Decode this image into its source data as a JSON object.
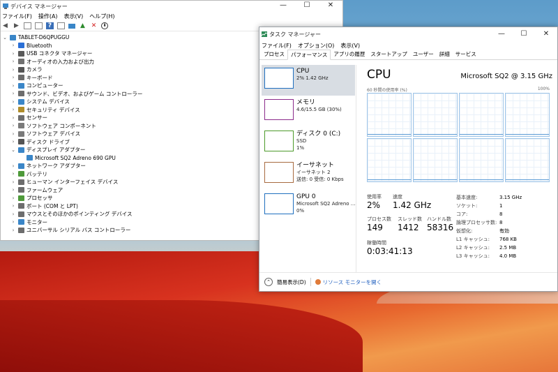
{
  "devmgr": {
    "title": "デバイス マネージャー",
    "menu": [
      "ファイル(F)",
      "操作(A)",
      "表示(V)",
      "ヘルプ(H)"
    ],
    "root": "TABLET-D6QPUGGU",
    "items": [
      {
        "label": "Bluetooth",
        "color": "#2a6fd6",
        "expanded": false
      },
      {
        "label": "USB コネクタ マネージャー",
        "color": "#5a5a5a",
        "expanded": false
      },
      {
        "label": "オーディオの入力および出力",
        "color": "#707070",
        "expanded": false
      },
      {
        "label": "カメラ",
        "color": "#555555",
        "expanded": false
      },
      {
        "label": "キーボード",
        "color": "#6d6d6d",
        "expanded": false
      },
      {
        "label": "コンピューター",
        "color": "#3a86c8",
        "expanded": false
      },
      {
        "label": "サウンド、ビデオ、およびゲーム コントローラー",
        "color": "#6d6d6d",
        "expanded": false
      },
      {
        "label": "システム デバイス",
        "color": "#3a86c8",
        "expanded": false
      },
      {
        "label": "セキュリティ デバイス",
        "color": "#b08d2a",
        "expanded": false
      },
      {
        "label": "センサー",
        "color": "#6d6d6d",
        "expanded": false
      },
      {
        "label": "ソフトウェア コンポーネント",
        "color": "#7a7a7a",
        "expanded": false
      },
      {
        "label": "ソフトウェア デバイス",
        "color": "#7a7a7a",
        "expanded": false
      },
      {
        "label": "ディスク ドライブ",
        "color": "#555555",
        "expanded": false
      },
      {
        "label": "ディスプレイ アダプター",
        "color": "#3a86c8",
        "expanded": true
      },
      {
        "label": "Microsoft SQ2 Adreno 690 GPU",
        "color": "#3a86c8",
        "child": true
      },
      {
        "label": "ネットワーク アダプター",
        "color": "#3a86c8",
        "expanded": false
      },
      {
        "label": "バッテリ",
        "color": "#4e9a3a",
        "expanded": false
      },
      {
        "label": "ヒューマン インターフェイス デバイス",
        "color": "#6d6d6d",
        "expanded": false
      },
      {
        "label": "ファームウェア",
        "color": "#6d6d6d",
        "expanded": false
      },
      {
        "label": "プロセッサ",
        "color": "#4e9a3a",
        "expanded": false
      },
      {
        "label": "ポート (COM と LPT)",
        "color": "#6d6d6d",
        "expanded": false
      },
      {
        "label": "マウスとそのほかのポインティング デバイス",
        "color": "#6d6d6d",
        "expanded": false
      },
      {
        "label": "モニター",
        "color": "#3a86c8",
        "expanded": false
      },
      {
        "label": "ユニバーサル シリアル バス コントローラー",
        "color": "#6d6d6d",
        "expanded": false
      }
    ]
  },
  "taskmgr": {
    "title": "タスク マネージャー",
    "menu": [
      "ファイル(F)",
      "オプション(O)",
      "表示(V)"
    ],
    "tabs": [
      "プロセス",
      "パフォーマンス",
      "アプリの履歴",
      "スタートアップ",
      "ユーザー",
      "詳細",
      "サービス"
    ],
    "active_tab": 1,
    "resources": [
      {
        "name": "CPU",
        "line1": "2%  1.42 GHz",
        "line2": "",
        "color": "#1f6fbf",
        "selected": true
      },
      {
        "name": "メモリ",
        "line1": "4.6/15.5 GB (30%)",
        "line2": "",
        "color": "#8b2b8b",
        "selected": false
      },
      {
        "name": "ディスク 0 (C:)",
        "line1": "SSD",
        "line2": "1%",
        "color": "#4c9a2a",
        "selected": false
      },
      {
        "name": "イーサネット",
        "line1": "イーサネット 2",
        "line2": "送信: 0  受信: 0 Kbps",
        "color": "#a76a3f",
        "selected": false
      },
      {
        "name": "GPU 0",
        "line1": "Microsoft SQ2 Adreno ...",
        "line2": "0%",
        "color": "#1f6fbf",
        "selected": false
      }
    ],
    "cpu": {
      "title": "CPU",
      "model": "Microsoft SQ2 @ 3.15 GHz",
      "graph_label": "60 秒間の使用率 (%)",
      "graph_max": "100%",
      "stats": [
        {
          "label": "使用率",
          "value": "2%"
        },
        {
          "label": "速度",
          "value": "1.42 GHz"
        },
        {
          "label": "プロセス数",
          "value": "149"
        },
        {
          "label": "スレッド数",
          "value": "1412"
        },
        {
          "label": "ハンドル数",
          "value": "58316"
        },
        {
          "label": "稼働時間",
          "value": "0:03:41:13"
        }
      ],
      "specs": [
        {
          "k": "基本速度:",
          "v": "3.15 GHz"
        },
        {
          "k": "ソケット:",
          "v": "1"
        },
        {
          "k": "コア:",
          "v": "8"
        },
        {
          "k": "論理プロセッサ数:",
          "v": "8"
        },
        {
          "k": "仮想化:",
          "v": "有効"
        },
        {
          "k": "L1 キャッシュ:",
          "v": "768 KB"
        },
        {
          "k": "L2 キャッシュ:",
          "v": "2.5 MB"
        },
        {
          "k": "L3 キャッシュ:",
          "v": "4.0 MB"
        }
      ]
    },
    "fewer_details": "簡易表示(D)",
    "resource_monitor": "リソース モニターを開く"
  },
  "window_buttons": {
    "min": "—",
    "max": "☐",
    "close": "✕"
  }
}
